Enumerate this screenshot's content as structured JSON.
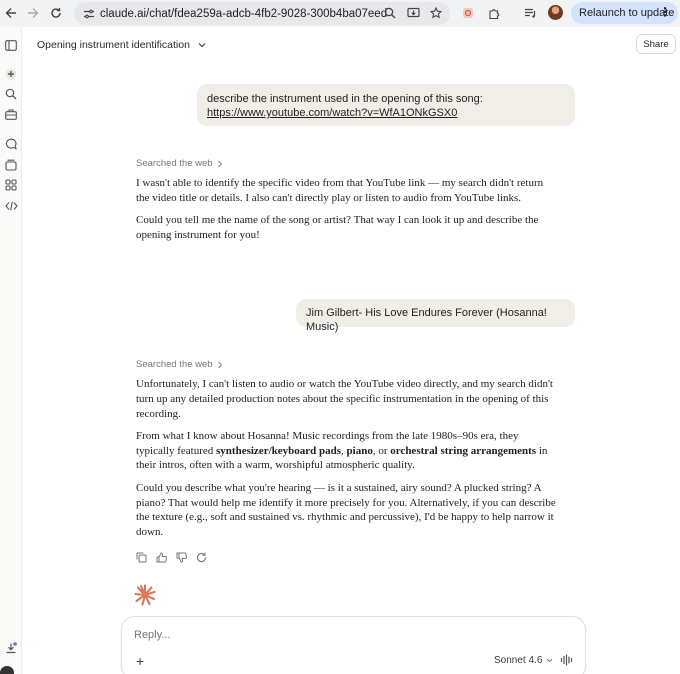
{
  "browser": {
    "url": "claude.ai/chat/fdea259a-adcb-4fb2-9028-300b4ba07eed",
    "relaunch_label": "Relaunch to update"
  },
  "chat": {
    "title": "Opening instrument identification",
    "share_label": "Share"
  },
  "messages": {
    "user1_line1": "describe the instrument used in the opening of this song:",
    "user1_link": "https://www.youtube.com/watch?v=WfA1ONkGSX0",
    "searched_label": "Searched the web",
    "resp1_p1": "I wasn't able to identify the specific video from that YouTube link — my search didn't return the video title or details. I also can't directly play or listen to audio from YouTube links.",
    "resp1_p2": "Could you tell me the name of the song or artist? That way I can look it up and describe the opening instrument for you!",
    "user2": "Jim Gilbert- His Love Endures Forever (Hosanna! Music)",
    "resp2_p1": "Unfortunately, I can't listen to audio or watch the YouTube video directly, and my search didn't turn up any detailed production notes about the specific instrumentation in the opening of this recording.",
    "resp2_p2_a": "From what I know about Hosanna! Music recordings from the late 1980s–90s era, they typically featured ",
    "resp2_p2_b1": "synthesizer/keyboard pads",
    "resp2_p2_c": ", ",
    "resp2_p2_b2": "piano",
    "resp2_p2_d": ", or ",
    "resp2_p2_b3": "orchestral string arrangements",
    "resp2_p2_e": " in their intros, often with a warm, worshipful atmospheric quality.",
    "resp2_p3": "Could you describe what you're hearing — is it a sustained, airy sound? A plucked string? A piano? That would help me identify it more precisely for you. Alternatively, if you can describe the texture (e.g., soft and sustained vs. rhythmic and percussive), I'd be happy to help narrow it down."
  },
  "composer": {
    "placeholder": "Reply...",
    "model": "Sonnet 4.6"
  },
  "colors": {
    "accent": "#d97757",
    "bubble": "#f0eee6"
  }
}
